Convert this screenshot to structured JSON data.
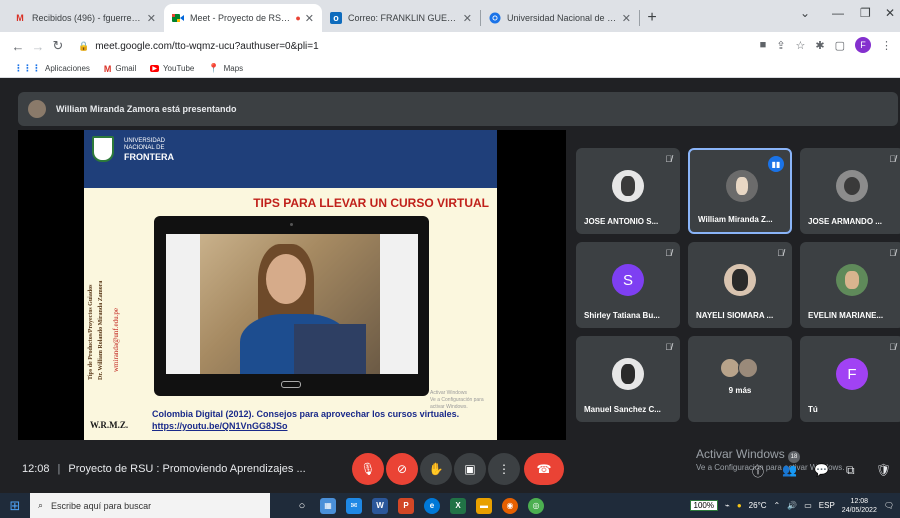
{
  "browser": {
    "tabs": [
      {
        "title": "Recibidos (496) - fguerrero@unf…",
        "icon": "gmail-icon"
      },
      {
        "title": "Meet - Proyecto de RSU : Pr…",
        "icon": "meet-icon",
        "active": true
      },
      {
        "title": "Correo: FRANKLIN GUERRERO C…",
        "icon": "outlook-icon"
      },
      {
        "title": "Universidad Nacional de Fronte…",
        "icon": "chrome-icon"
      }
    ],
    "url": "meet.google.com/tto-wqmz-ucu?authuser=0&pli=1",
    "profile_initial": "F",
    "bookmarks": [
      {
        "label": "Aplicaciones",
        "icon": "apps-icon"
      },
      {
        "label": "Gmail",
        "icon": "gmail-icon"
      },
      {
        "label": "YouTube",
        "icon": "youtube-icon"
      },
      {
        "label": "Maps",
        "icon": "maps-icon"
      }
    ]
  },
  "meet": {
    "presenting_banner": "William Miranda Zamora está presentando",
    "slide": {
      "uni_line1": "UNIVERSIDAD",
      "uni_line2": "NACIONAL DE",
      "uni_line3": "FRONTERA",
      "title": "TIPS PARA LLEVAR UN CURSO VIRTUAL",
      "side_text1": "Tips de Productos/Proyectos Guiados",
      "side_text2": "Dr. William Rolando Miranda Zamora",
      "side_email": "wmiranda@unf.edu.pe",
      "signature": "W.R.M.Z.",
      "citation": "Colombia Digital (2012). Consejos para aprovechar los cursos virtuales.",
      "link": "https://youtu.be/QN1VnGG8JSo",
      "watermark_line1": "Activar Windows",
      "watermark_line2": "Ve a Configuración para activar Windows."
    },
    "participants": [
      {
        "name": "JOSE ANTONIO S...",
        "avatar": "photo",
        "color": "#e6e6e6"
      },
      {
        "name": "William Miranda Z...",
        "avatar": "photo",
        "color": "#6b6b6b",
        "speaking": true
      },
      {
        "name": "JOSE ARMANDO ...",
        "avatar": "photo",
        "color": "#8c8c8c"
      },
      {
        "name": "Shirley Tatiana Bu...",
        "avatar": "S",
        "color": "#7e3ff2"
      },
      {
        "name": "NAYELI SIOMARA ...",
        "avatar": "photo",
        "color": "#d9c4b0"
      },
      {
        "name": "EVELIN MARIANE...",
        "avatar": "photo",
        "color": "#5f8a5a"
      },
      {
        "name": "Manuel Sanchez C...",
        "avatar": "photo",
        "color": "#e6e6e6"
      },
      {
        "name": "9 más",
        "avatar": "group"
      },
      {
        "name": "Tú",
        "avatar": "F",
        "color": "#a142f4"
      }
    ],
    "bottom": {
      "time": "12:08",
      "meeting_name": "Proyecto de RSU : Promoviendo Aprendizajes ...",
      "activate_windows": "Activar Windows",
      "activate_windows_sub": "Ve a Configuración para activar Windows.",
      "people_count": "18"
    }
  },
  "taskbar": {
    "search_placeholder": "Escribe aquí para buscar",
    "zoom": "100%",
    "temperature": "26°C",
    "language": "ESP",
    "time": "12:08",
    "date": "24/05/2022"
  }
}
